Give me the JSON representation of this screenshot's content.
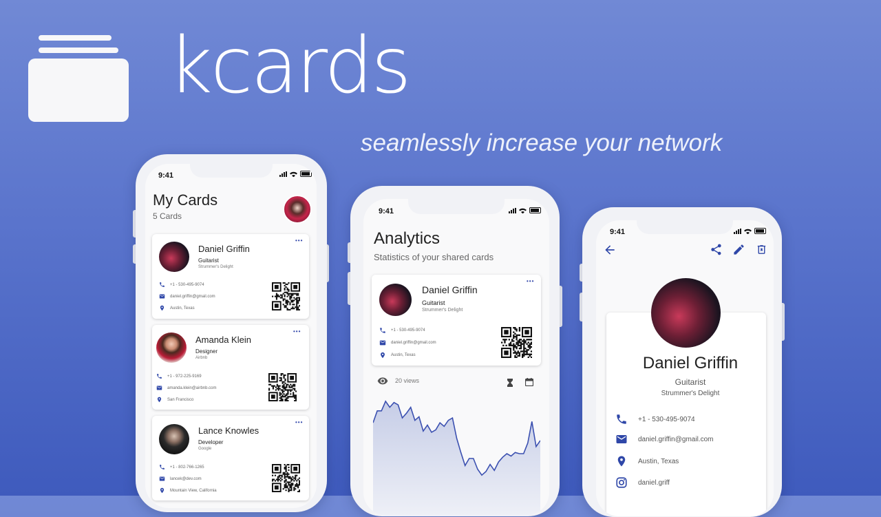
{
  "brand": {
    "name": "kcards",
    "tagline": "seamlessly increase your network"
  },
  "status_time": "9:41",
  "my_cards": {
    "title": "My Cards",
    "count": "5 Cards",
    "more": "•••",
    "cards": [
      {
        "name": "Daniel Griffin",
        "role": "Guitarist",
        "company": "Strummer's Delight",
        "phone": "+1 - 530-495-9074",
        "email": "daniel.griffin@gmail.com",
        "location": "Austin, Texas"
      },
      {
        "name": "Amanda Klein",
        "role": "Designer",
        "company": "Airbnb",
        "phone": "+1 - 972-225-9169",
        "email": "amanda.klein@airbnb.com",
        "location": "San Francisco"
      },
      {
        "name": "Lance Knowles",
        "role": "Developer",
        "company": "Google",
        "phone": "+1 - 802-766-1265",
        "email": "lancek@dev.com",
        "location": "Mountain View, California"
      }
    ]
  },
  "analytics": {
    "title": "Analytics",
    "subtitle": "Statistics of your shared cards",
    "card": {
      "name": "Daniel Griffin",
      "role": "Guitarist",
      "company": "Strummer's Delight",
      "phone": "+1 - 530-495-9074",
      "email": "daniel.griffin@gmail.com",
      "location": "Austin, Texas"
    },
    "views": "20 views"
  },
  "detail": {
    "name": "Daniel Griffin",
    "role": "Guitarist",
    "company": "Strummer's Delight",
    "phone": "+1 - 530-495-9074",
    "email": "daniel.griffin@gmail.com",
    "location": "Austin, Texas",
    "instagram": "daniel.griff"
  },
  "chart_data": {
    "type": "area",
    "values": [
      78,
      88,
      88,
      96,
      91,
      95,
      93,
      82,
      86,
      91,
      80,
      83,
      71,
      76,
      70,
      72,
      78,
      75,
      80,
      82,
      65,
      53,
      42,
      48,
      48,
      39,
      34,
      37,
      43,
      38,
      45,
      49,
      52,
      50,
      53,
      52,
      52,
      61,
      79,
      58,
      63
    ],
    "ylim": [
      0,
      100
    ],
    "grid": false,
    "colors": {
      "line": "#3b50b0",
      "fill": "#c9d0e8"
    }
  },
  "colors": {
    "accent": "#3b4fae",
    "background": "#5b74cc"
  }
}
